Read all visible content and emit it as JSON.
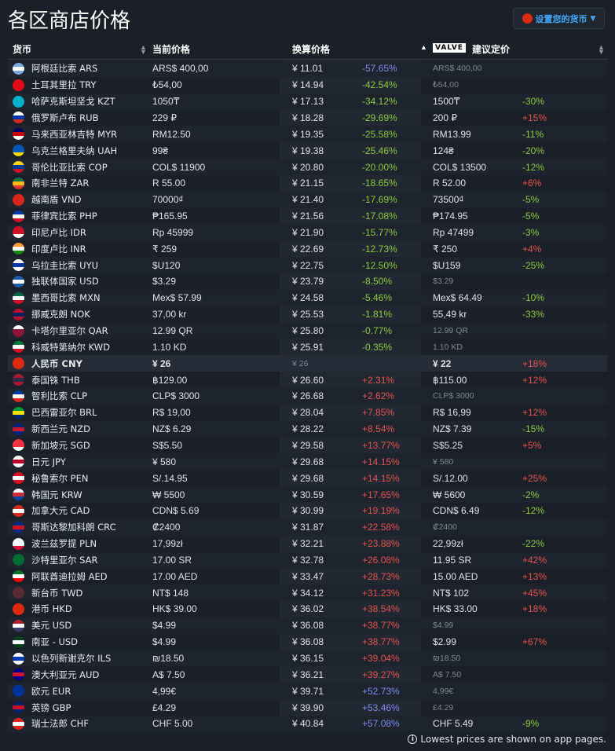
{
  "title": "各区商店价格",
  "currency_button": {
    "label": "设置您的货币",
    "flag_color": "#de2910"
  },
  "headers": {
    "currency": "货币",
    "current_price": "当前价格",
    "converted_price": "换算价格",
    "valve_badge": "VALVE",
    "recommended_price": "建议定价"
  },
  "footer": {
    "text": "Lowest prices are shown on app pages."
  },
  "colors": {
    "positive": "#e2534e",
    "negative": "#8ccb3f",
    "accent": "#45a8ff"
  },
  "rows": [
    {
      "name": "阿根廷比索 ARS",
      "price": "ARS$ 400,00",
      "conv": "¥ 11.01",
      "pct": "-57.65%",
      "pct_kind": "blue",
      "rec": "ARS$ 400,00",
      "rec_muted": true,
      "rpct": "",
      "rpct_kind": "",
      "flag": [
        "#74acdf",
        "#ffffff",
        "#74acdf"
      ]
    },
    {
      "name": "土耳其里拉 TRY",
      "price": "₺54,00",
      "conv": "¥ 14.94",
      "pct": "-42.54%",
      "pct_kind": "neg",
      "rec": "₺54,00",
      "rec_muted": true,
      "rpct": "",
      "rpct_kind": "",
      "flag": [
        "#e30a17",
        "#e30a17",
        "#e30a17"
      ]
    },
    {
      "name": "哈萨克斯坦坚戈 KZT",
      "price": "1050₸",
      "conv": "¥ 17.13",
      "pct": "-34.12%",
      "pct_kind": "neg",
      "rec": "1500₸",
      "rec_muted": false,
      "rpct": "-30%",
      "rpct_kind": "neg",
      "flag": [
        "#00afca",
        "#00afca",
        "#00afca"
      ]
    },
    {
      "name": "俄罗斯卢布 RUB",
      "price": "229 ₽",
      "conv": "¥ 18.28",
      "pct": "-29.69%",
      "pct_kind": "neg",
      "rec": "200 ₽",
      "rec_muted": false,
      "rpct": "+15%",
      "rpct_kind": "pos",
      "flag": [
        "#ffffff",
        "#0039a6",
        "#d52b1e"
      ]
    },
    {
      "name": "马来西亚林吉特 MYR",
      "price": "RM12.50",
      "conv": "¥ 19.35",
      "pct": "-25.58%",
      "pct_kind": "neg",
      "rec": "RM13.99",
      "rec_muted": false,
      "rpct": "-11%",
      "rpct_kind": "neg",
      "flag": [
        "#010066",
        "#cc0001",
        "#ffffff"
      ]
    },
    {
      "name": "乌克兰格里夫纳 UAH",
      "price": "99₴",
      "conv": "¥ 19.38",
      "pct": "-25.46%",
      "pct_kind": "neg",
      "rec": "124₴",
      "rec_muted": false,
      "rpct": "-20%",
      "rpct_kind": "neg",
      "flag": [
        "#0057b7",
        "#0057b7",
        "#ffd700"
      ]
    },
    {
      "name": "哥伦比亚比索 COP",
      "price": "COL$ 11900",
      "conv": "¥ 20.80",
      "pct": "-20.00%",
      "pct_kind": "neg",
      "rec": "COL$ 13500",
      "rec_muted": false,
      "rpct": "-12%",
      "rpct_kind": "neg",
      "flag": [
        "#fcd116",
        "#003893",
        "#ce1126"
      ]
    },
    {
      "name": "南非兰特 ZAR",
      "price": "R 55.00",
      "conv": "¥ 21.15",
      "pct": "-18.65%",
      "pct_kind": "neg",
      "rec": "R 52.00",
      "rec_muted": false,
      "rpct": "+6%",
      "rpct_kind": "pos",
      "flag": [
        "#007749",
        "#ffb81c",
        "#de3831"
      ]
    },
    {
      "name": "越南盾 VND",
      "price": "70000₫",
      "conv": "¥ 21.40",
      "pct": "-17.69%",
      "pct_kind": "neg",
      "rec": "73500₫",
      "rec_muted": false,
      "rpct": "-5%",
      "rpct_kind": "neg",
      "flag": [
        "#da251d",
        "#da251d",
        "#da251d"
      ]
    },
    {
      "name": "菲律宾比索 PHP",
      "price": "₱165.95",
      "conv": "¥ 21.56",
      "pct": "-17.08%",
      "pct_kind": "neg",
      "rec": "₱174.95",
      "rec_muted": false,
      "rpct": "-5%",
      "rpct_kind": "neg",
      "flag": [
        "#0038a8",
        "#ffffff",
        "#ce1126"
      ]
    },
    {
      "name": "印尼卢比 IDR",
      "price": "Rp 45999",
      "conv": "¥ 21.90",
      "pct": "-15.77%",
      "pct_kind": "neg",
      "rec": "Rp 47499",
      "rec_muted": false,
      "rpct": "-3%",
      "rpct_kind": "neg",
      "flag": [
        "#ce1126",
        "#ce1126",
        "#ffffff"
      ]
    },
    {
      "name": "印度卢比 INR",
      "price": "₹ 259",
      "conv": "¥ 22.69",
      "pct": "-12.73%",
      "pct_kind": "neg",
      "rec": "₹ 250",
      "rec_muted": false,
      "rpct": "+4%",
      "rpct_kind": "pos",
      "flag": [
        "#ff9933",
        "#ffffff",
        "#138808"
      ]
    },
    {
      "name": "乌拉圭比索 UYU",
      "price": "$U120",
      "conv": "¥ 22.75",
      "pct": "-12.50%",
      "pct_kind": "neg",
      "rec": "$U159",
      "rec_muted": false,
      "rpct": "-25%",
      "rpct_kind": "neg",
      "flag": [
        "#ffffff",
        "#0038a8",
        "#ffffff"
      ]
    },
    {
      "name": "独联体国家 USD",
      "price": "$3.29",
      "conv": "¥ 23.79",
      "pct": "-8.50%",
      "pct_kind": "neg",
      "rec": "$3.29",
      "rec_muted": true,
      "rpct": "",
      "rpct_kind": "",
      "flag": [
        "#1a5aa6",
        "#ffffff",
        "#1a5aa6"
      ]
    },
    {
      "name": "墨西哥比索 MXN",
      "price": "Mex$ 57.99",
      "conv": "¥ 24.58",
      "pct": "-5.46%",
      "pct_kind": "neg",
      "rec": "Mex$ 64.49",
      "rec_muted": false,
      "rpct": "-10%",
      "rpct_kind": "neg",
      "flag": [
        "#006847",
        "#ffffff",
        "#ce1126"
      ]
    },
    {
      "name": "挪威克朗 NOK",
      "price": "37,00 kr",
      "conv": "¥ 25.53",
      "pct": "-1.81%",
      "pct_kind": "neg",
      "rec": "55,49 kr",
      "rec_muted": false,
      "rpct": "-33%",
      "rpct_kind": "neg",
      "flag": [
        "#ba0c2f",
        "#00205b",
        "#ba0c2f"
      ]
    },
    {
      "name": "卡塔尔里亚尔 QAR",
      "price": "12.99 QR",
      "conv": "¥ 25.80",
      "pct": "-0.77%",
      "pct_kind": "neg",
      "rec": "12.99 QR",
      "rec_muted": true,
      "rpct": "",
      "rpct_kind": "",
      "flag": [
        "#ffffff",
        "#8a1538",
        "#8a1538"
      ]
    },
    {
      "name": "科威特第纳尔 KWD",
      "price": "1.10 KD",
      "conv": "¥ 25.91",
      "pct": "-0.35%",
      "pct_kind": "neg",
      "rec": "1.10 KD",
      "rec_muted": true,
      "rpct": "",
      "rpct_kind": "",
      "flag": [
        "#007a3d",
        "#ffffff",
        "#ce1126"
      ]
    },
    {
      "name": "人民币 CNY",
      "price": "¥ 26",
      "conv": "¥ 26",
      "pct": "",
      "pct_kind": "",
      "rec": "¥ 22",
      "rec_muted": false,
      "rpct": "+18%",
      "rpct_kind": "pos",
      "flag": [
        "#de2910",
        "#de2910",
        "#de2910"
      ],
      "highlight": true
    },
    {
      "name": "泰国铢 THB",
      "price": "฿129.00",
      "conv": "¥ 26.60",
      "pct": "+2.31%",
      "pct_kind": "pos",
      "rec": "฿115.00",
      "rec_muted": false,
      "rpct": "+12%",
      "rpct_kind": "pos",
      "flag": [
        "#a51931",
        "#2d2a4a",
        "#a51931"
      ]
    },
    {
      "name": "智利比索 CLP",
      "price": "CLP$ 3000",
      "conv": "¥ 26.68",
      "pct": "+2.62%",
      "pct_kind": "pos",
      "rec": "CLP$ 3000",
      "rec_muted": true,
      "rpct": "",
      "rpct_kind": "",
      "flag": [
        "#0039a6",
        "#ffffff",
        "#d52b1e"
      ]
    },
    {
      "name": "巴西雷亚尔 BRL",
      "price": "R$ 19,00",
      "conv": "¥ 28.04",
      "pct": "+7.85%",
      "pct_kind": "pos",
      "rec": "R$ 16,99",
      "rec_muted": false,
      "rpct": "+12%",
      "rpct_kind": "pos",
      "flag": [
        "#009c3b",
        "#ffdf00",
        "#002776"
      ]
    },
    {
      "name": "新西兰元 NZD",
      "price": "NZ$ 6.29",
      "conv": "¥ 28.22",
      "pct": "+8.54%",
      "pct_kind": "pos",
      "rec": "NZ$ 7.39",
      "rec_muted": false,
      "rpct": "-15%",
      "rpct_kind": "neg",
      "flag": [
        "#00247d",
        "#cc142b",
        "#00247d"
      ]
    },
    {
      "name": "新加坡元 SGD",
      "price": "S$5.50",
      "conv": "¥ 29.58",
      "pct": "+13.77%",
      "pct_kind": "pos",
      "rec": "S$5.25",
      "rec_muted": false,
      "rpct": "+5%",
      "rpct_kind": "pos",
      "flag": [
        "#ef3340",
        "#ef3340",
        "#ffffff"
      ]
    },
    {
      "name": "日元 JPY",
      "price": "¥ 580",
      "conv": "¥ 29.68",
      "pct": "+14.15%",
      "pct_kind": "pos",
      "rec": "¥ 580",
      "rec_muted": true,
      "rpct": "",
      "rpct_kind": "",
      "flag": [
        "#ffffff",
        "#bc002d",
        "#ffffff"
      ]
    },
    {
      "name": "秘鲁索尔 PEN",
      "price": "S/.14.95",
      "conv": "¥ 29.68",
      "pct": "+14.15%",
      "pct_kind": "pos",
      "rec": "S/.12.00",
      "rec_muted": false,
      "rpct": "+25%",
      "rpct_kind": "pos",
      "flag": [
        "#d91023",
        "#ffffff",
        "#d91023"
      ]
    },
    {
      "name": "韩国元 KRW",
      "price": "₩ 5500",
      "conv": "¥ 30.59",
      "pct": "+17.65%",
      "pct_kind": "pos",
      "rec": "₩ 5600",
      "rec_muted": false,
      "rpct": "-2%",
      "rpct_kind": "neg",
      "flag": [
        "#ffffff",
        "#cd2e3a",
        "#0047a0"
      ]
    },
    {
      "name": "加拿大元 CAD",
      "price": "CDN$ 5.69",
      "conv": "¥ 30.99",
      "pct": "+19.19%",
      "pct_kind": "pos",
      "rec": "CDN$ 6.49",
      "rec_muted": false,
      "rpct": "-12%",
      "rpct_kind": "neg",
      "flag": [
        "#d52b1e",
        "#ffffff",
        "#d52b1e"
      ]
    },
    {
      "name": "哥斯达黎加科朗 CRC",
      "price": "₡2400",
      "conv": "¥ 31.87",
      "pct": "+22.58%",
      "pct_kind": "pos",
      "rec": "₡2400",
      "rec_muted": true,
      "rpct": "",
      "rpct_kind": "",
      "flag": [
        "#002b7f",
        "#ce1126",
        "#002b7f"
      ]
    },
    {
      "name": "波兰兹罗提 PLN",
      "price": "17,99zł",
      "conv": "¥ 32.21",
      "pct": "+23.88%",
      "pct_kind": "pos",
      "rec": "22,99zł",
      "rec_muted": false,
      "rpct": "-22%",
      "rpct_kind": "neg",
      "flag": [
        "#ffffff",
        "#ffffff",
        "#dc143c"
      ]
    },
    {
      "name": "沙特里亚尔 SAR",
      "price": "17.00 SR",
      "conv": "¥ 32.78",
      "pct": "+26.08%",
      "pct_kind": "pos",
      "rec": "11.95 SR",
      "rec_muted": false,
      "rpct": "+42%",
      "rpct_kind": "pos",
      "flag": [
        "#006c35",
        "#006c35",
        "#006c35"
      ]
    },
    {
      "name": "阿联酋迪拉姆 AED",
      "price": "17.00 AED",
      "conv": "¥ 33.47",
      "pct": "+28.73%",
      "pct_kind": "pos",
      "rec": "15.00 AED",
      "rec_muted": false,
      "rpct": "+13%",
      "rpct_kind": "pos",
      "flag": [
        "#00732f",
        "#ffffff",
        "#ff0000"
      ]
    },
    {
      "name": "新台币 TWD",
      "price": "NT$ 148",
      "conv": "¥ 34.12",
      "pct": "+31.23%",
      "pct_kind": "pos",
      "rec": "NT$ 102",
      "rec_muted": false,
      "rpct": "+45%",
      "rpct_kind": "pos",
      "flag": [
        "#5a2a33",
        "#5a2a33",
        "#5a2a33"
      ]
    },
    {
      "name": "港币 HKD",
      "price": "HK$ 39.00",
      "conv": "¥ 36.02",
      "pct": "+38.54%",
      "pct_kind": "pos",
      "rec": "HK$ 33.00",
      "rec_muted": false,
      "rpct": "+18%",
      "rpct_kind": "pos",
      "flag": [
        "#de2910",
        "#de2910",
        "#de2910"
      ]
    },
    {
      "name": "美元 USD",
      "price": "$4.99",
      "conv": "¥ 36.08",
      "pct": "+38.77%",
      "pct_kind": "pos",
      "rec": "$4.99",
      "rec_muted": true,
      "rpct": "",
      "rpct_kind": "",
      "flag": [
        "#b22234",
        "#ffffff",
        "#3c3b6e"
      ]
    },
    {
      "name": "南亚 - USD",
      "price": "$4.99",
      "conv": "¥ 36.08",
      "pct": "+38.77%",
      "pct_kind": "pos",
      "rec": "$2.99",
      "rec_muted": false,
      "rpct": "+67%",
      "rpct_kind": "pos",
      "flag": [
        "#01411c",
        "#ffffff",
        "#01411c"
      ]
    },
    {
      "name": "以色列新谢克尔 ILS",
      "price": "₪18.50",
      "conv": "¥ 36.15",
      "pct": "+39.04%",
      "pct_kind": "pos",
      "rec": "₪18.50",
      "rec_muted": true,
      "rpct": "",
      "rpct_kind": "",
      "flag": [
        "#ffffff",
        "#0038b8",
        "#ffffff"
      ]
    },
    {
      "name": "澳大利亚元 AUD",
      "price": "A$ 7.50",
      "conv": "¥ 36.21",
      "pct": "+39.27%",
      "pct_kind": "pos",
      "rec": "A$ 7.50",
      "rec_muted": true,
      "rpct": "",
      "rpct_kind": "",
      "flag": [
        "#00008b",
        "#cc142b",
        "#00008b"
      ]
    },
    {
      "name": "欧元 EUR",
      "price": "4,99€",
      "conv": "¥ 39.71",
      "pct": "+52.73%",
      "pct_kind": "blue",
      "rec": "4,99€",
      "rec_muted": true,
      "rpct": "",
      "rpct_kind": "",
      "flag": [
        "#003399",
        "#003399",
        "#003399"
      ]
    },
    {
      "name": "英镑 GBP",
      "price": "£4.29",
      "conv": "¥ 39.90",
      "pct": "+53.46%",
      "pct_kind": "blue",
      "rec": "£4.29",
      "rec_muted": true,
      "rpct": "",
      "rpct_kind": "",
      "flag": [
        "#012169",
        "#c8102e",
        "#012169"
      ]
    },
    {
      "name": "瑞士法郎 CHF",
      "price": "CHF 5.00",
      "conv": "¥ 40.84",
      "pct": "+57.08%",
      "pct_kind": "blue",
      "rec": "CHF 5.49",
      "rec_muted": false,
      "rpct": "-9%",
      "rpct_kind": "neg",
      "flag": [
        "#da291c",
        "#ffffff",
        "#da291c"
      ]
    }
  ]
}
